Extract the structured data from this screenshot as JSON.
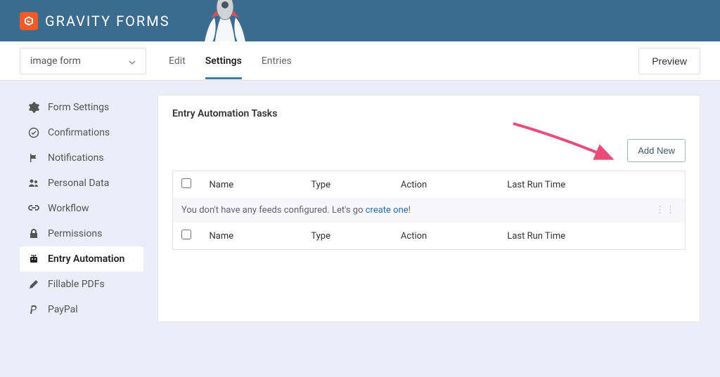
{
  "header": {
    "brand": "GRAVITY FORMS"
  },
  "nav": {
    "form_selector": "image form",
    "tabs": [
      "Edit",
      "Settings",
      "Entries"
    ],
    "active_tab": "Settings",
    "preview": "Preview"
  },
  "sidebar": {
    "items": [
      {
        "label": "Form Settings",
        "icon": "gear"
      },
      {
        "label": "Confirmations",
        "icon": "check"
      },
      {
        "label": "Notifications",
        "icon": "flag"
      },
      {
        "label": "Personal Data",
        "icon": "people"
      },
      {
        "label": "Workflow",
        "icon": "link"
      },
      {
        "label": "Permissions",
        "icon": "lock"
      },
      {
        "label": "Entry Automation",
        "icon": "robot"
      },
      {
        "label": "Fillable PDFs",
        "icon": "pen"
      },
      {
        "label": "PayPal",
        "icon": "paypal"
      }
    ],
    "active_index": 6
  },
  "panel": {
    "title": "Entry Automation Tasks",
    "add_new": "Add New",
    "columns": [
      "Name",
      "Type",
      "Action",
      "Last Run Time"
    ],
    "empty_prefix": "You don't have any feeds configured. Let's go ",
    "empty_link": "create one",
    "empty_suffix": "!"
  },
  "annotation": {
    "arrow_color": "#e94b7a"
  }
}
